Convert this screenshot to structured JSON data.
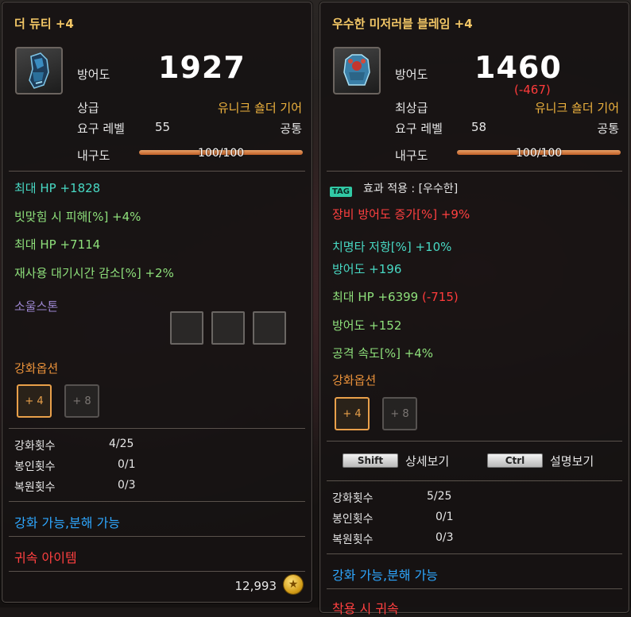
{
  "item1": {
    "title": "더 듀티 +4",
    "icon": "shoulder-armor-blue-icon",
    "defense_label": "방어도",
    "defense_value": "1927",
    "grade_label": "상급",
    "category": "유니크 숄더 기어",
    "req_level_label": "요구 레벨",
    "req_level_value": "55",
    "class": "공통",
    "durability_label": "내구도",
    "durability_text": "100/100",
    "durability_fraction": 1.0,
    "stats": [
      {
        "text": "최대 HP +1828",
        "color": "cyan"
      },
      {
        "text": "빗맞힘 시 피해[%] +4%",
        "color": "green"
      },
      {
        "text": "최대 HP +7114",
        "color": "green"
      },
      {
        "text": "재사용 대기시간 감소[%] +2%",
        "color": "green"
      }
    ],
    "soulstone_label": "소울스톤",
    "enhance_label": "강화옵션",
    "enhance_on": "+ 4",
    "enhance_off": "+ 8",
    "counts": [
      {
        "label": "강화횟수",
        "value": "4/25"
      },
      {
        "label": "봉인횟수",
        "value": "0/1"
      },
      {
        "label": "복원횟수",
        "value": "0/3"
      }
    ],
    "tradable": "강화 가능,분해 가능",
    "bound": "귀속 아이템",
    "price": "12,993"
  },
  "item2": {
    "title": "우수한 미저러블 블레임 +4",
    "icon": "chest-armor-blue-icon",
    "defense_label": "방어도",
    "defense_value": "1460",
    "defense_diff": "(-467)",
    "grade_label": "최상급",
    "category": "유니크 숄더 기어",
    "req_level_label": "요구 레벨",
    "req_level_value": "58",
    "class": "공통",
    "durability_label": "내구도",
    "durability_text": "100/100",
    "durability_fraction": 1.0,
    "tag_badge": "TAG",
    "tag_text": "효과 적용 : [우수한]",
    "tag_effect": "장비 방어도 증가[%] +9%",
    "stats": [
      {
        "text": "치명타 저항[%] +10%",
        "color": "cyan"
      },
      {
        "text": "방어도 +196",
        "color": "cyan"
      },
      {
        "text": "최대 HP +6399",
        "diff": "(-715)",
        "color": "green"
      },
      {
        "text": "방어도 +152",
        "color": "green"
      },
      {
        "text": "공격 속도[%] +4%",
        "color": "green"
      }
    ],
    "enhance_label": "강화옵션",
    "enhance_on": "+ 4",
    "enhance_off": "+ 8",
    "shift_key": "Shift",
    "shift_text": "상세보기",
    "ctrl_key": "Ctrl",
    "ctrl_text": "설명보기",
    "counts": [
      {
        "label": "강화횟수",
        "value": "5/25"
      },
      {
        "label": "봉인횟수",
        "value": "0/1"
      },
      {
        "label": "복원횟수",
        "value": "0/3"
      }
    ],
    "tradable": "강화 가능,분해 가능",
    "bound": "착용 시 귀속"
  }
}
